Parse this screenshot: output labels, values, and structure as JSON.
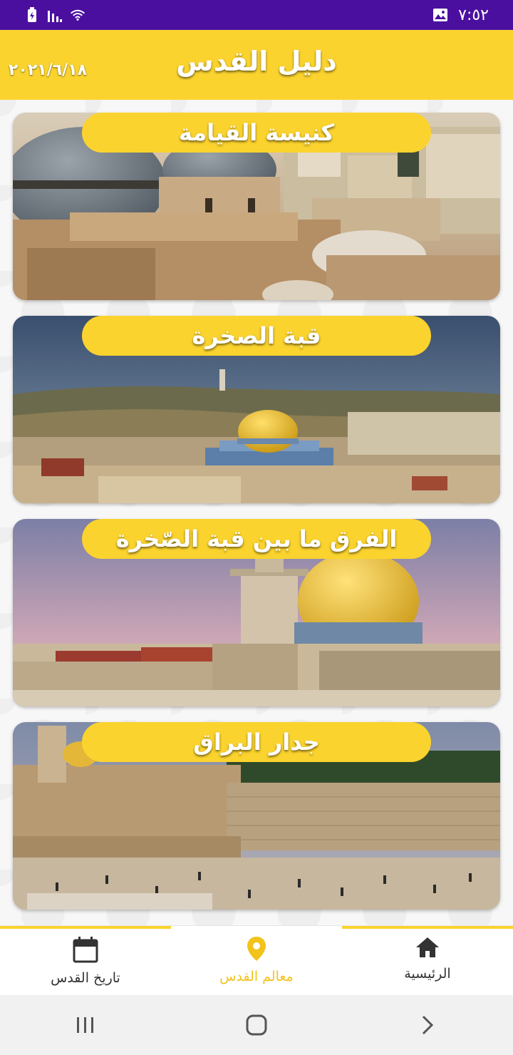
{
  "status_bar": {
    "time": "٧:٥٢",
    "icons": [
      "battery-charging-icon",
      "signal-icon",
      "wifi-icon",
      "gallery-notification-icon"
    ]
  },
  "app_bar": {
    "title": "دليل القدس",
    "date": "٢٠٢١/٦/١٨"
  },
  "cards": [
    {
      "label": "كنيسة القيامة",
      "image": "church-of-holy-sepulchre-domes"
    },
    {
      "label": "قبة الصخرة",
      "image": "dome-of-the-rock-panorama"
    },
    {
      "label": "الفرق ما بين قبة الصّخرة",
      "image": "dome-and-minaret-at-dusk"
    },
    {
      "label": "جدار البراق",
      "image": "western-wall-plaza"
    }
  ],
  "bottom_nav": {
    "items": [
      {
        "label": "تاريخ القدس",
        "icon": "calendar-icon",
        "active": false
      },
      {
        "label": "معالم القدس",
        "icon": "location-pin-icon",
        "active": true
      },
      {
        "label": "الرئيسية",
        "icon": "home-icon",
        "active": false
      }
    ]
  },
  "system_nav": [
    "recent-apps-icon",
    "home-button-icon",
    "back-icon"
  ],
  "colors": {
    "accent": "#fbd32e",
    "status_bar": "#4b0fa0",
    "active_nav": "#f2c31b"
  }
}
